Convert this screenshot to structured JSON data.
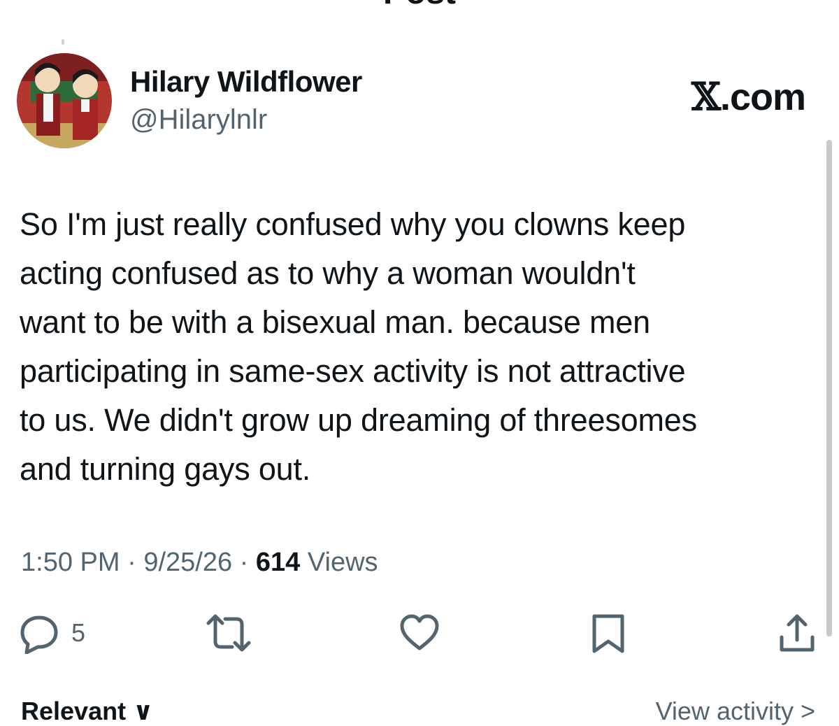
{
  "header": {
    "title": "Post"
  },
  "user": {
    "display_name": "Hilary Wildflower",
    "handle": "@Hilarylnlr"
  },
  "brand": {
    "x_glyph": "𝕏",
    "suffix": ".com"
  },
  "tweet": {
    "lines": [
      "So I'm just really confused why you clowns keep",
      "acting confused as to why a woman wouldn't",
      "want to be with a bisexual man. because men",
      "participating in same-sex activity is not attractive",
      "to us. We didn't grow up dreaming of threesomes",
      "and turning gays out."
    ]
  },
  "meta": {
    "time": "1:50 PM",
    "separator": " · ",
    "date": "9/25/26",
    "views_count": "614",
    "views_label": " Views"
  },
  "actions": {
    "reply_count": "5",
    "icons": [
      "reply-icon",
      "repost-icon",
      "like-icon",
      "bookmark-icon",
      "share-icon"
    ]
  },
  "bottom_tabs": {
    "left_label": "Relevant ∨",
    "right_label": "View activity >"
  },
  "colors": {
    "text": "#0f1419",
    "secondary": "#536471",
    "background": "#ffffff"
  }
}
